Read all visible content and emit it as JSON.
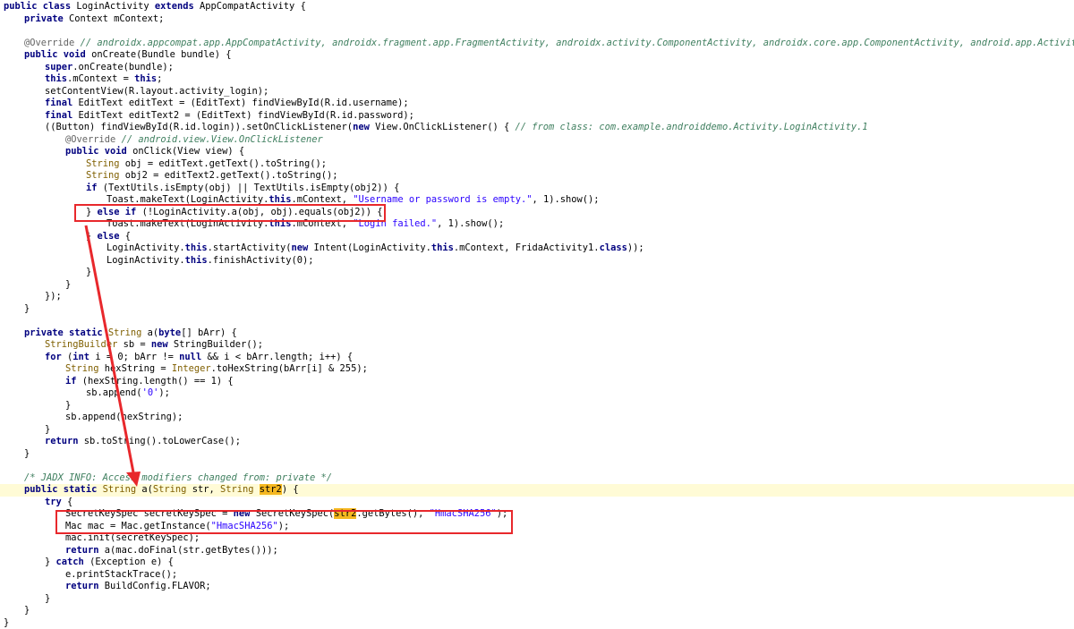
{
  "theme": {
    "annotation_color": "#e8282c",
    "highlight_line_color": "#fffbd6",
    "search_match_color": "#f5b820"
  },
  "lines": [
    {
      "indent": 0,
      "tokens": [
        {
          "t": "public class ",
          "c": "kw"
        },
        {
          "t": "LoginActivity "
        },
        {
          "t": "extends ",
          "c": "kw"
        },
        {
          "t": "AppCompatActivity {"
        }
      ]
    },
    {
      "indent": 1,
      "tokens": [
        {
          "t": "private ",
          "c": "kw"
        },
        {
          "t": "Context mContext;"
        }
      ]
    },
    {
      "indent": 0,
      "tokens": []
    },
    {
      "indent": 1,
      "tokens": [
        {
          "t": "@Override ",
          "c": "ann"
        },
        {
          "t": "// androidx.appcompat.app.AppCompatActivity, androidx.fragment.app.FragmentActivity, androidx.activity.ComponentActivity, androidx.core.app.ComponentActivity, android.app.Activity",
          "c": "comment"
        }
      ]
    },
    {
      "indent": 1,
      "tokens": [
        {
          "t": "public void ",
          "c": "kw"
        },
        {
          "t": "onCreate(Bundle bundle) {"
        }
      ]
    },
    {
      "indent": 2,
      "tokens": [
        {
          "t": "super",
          "c": "kw"
        },
        {
          "t": ".onCreate(bundle);"
        }
      ]
    },
    {
      "indent": 2,
      "tokens": [
        {
          "t": "this",
          "c": "kw"
        },
        {
          "t": ".mContext = "
        },
        {
          "t": "this",
          "c": "kw"
        },
        {
          "t": ";"
        }
      ]
    },
    {
      "indent": 2,
      "tokens": [
        {
          "t": "setContentView(R.layout.activity_login);"
        }
      ]
    },
    {
      "indent": 2,
      "tokens": [
        {
          "t": "final ",
          "c": "kw"
        },
        {
          "t": "EditText editText = (EditText) findViewById(R.id.username);"
        }
      ]
    },
    {
      "indent": 2,
      "tokens": [
        {
          "t": "final ",
          "c": "kw"
        },
        {
          "t": "EditText editText2 = (EditText) findViewById(R.id.password);"
        }
      ]
    },
    {
      "indent": 2,
      "tokens": [
        {
          "t": "((Button) findViewById(R.id.login)).setOnClickListener("
        },
        {
          "t": "new ",
          "c": "kw"
        },
        {
          "t": "View.OnClickListener() { "
        },
        {
          "t": "// from class: com.example.androiddemo.Activity.LoginActivity.1",
          "c": "comment"
        }
      ]
    },
    {
      "indent": 3,
      "tokens": [
        {
          "t": "@Override ",
          "c": "ann"
        },
        {
          "t": "// android.view.View.OnClickListener",
          "c": "comment"
        }
      ]
    },
    {
      "indent": 3,
      "tokens": [
        {
          "t": "public void ",
          "c": "kw"
        },
        {
          "t": "onClick(View view) {"
        }
      ]
    },
    {
      "indent": 4,
      "tokens": [
        {
          "t": "String ",
          "c": "type"
        },
        {
          "t": "obj = editText.getText().toString();"
        }
      ]
    },
    {
      "indent": 4,
      "tokens": [
        {
          "t": "String ",
          "c": "type"
        },
        {
          "t": "obj2 = editText2.getText().toString();"
        }
      ]
    },
    {
      "indent": 4,
      "tokens": [
        {
          "t": "if ",
          "c": "kw"
        },
        {
          "t": "(TextUtils.isEmpty(obj) || TextUtils.isEmpty(obj2)) {"
        }
      ]
    },
    {
      "indent": 5,
      "tokens": [
        {
          "t": "Toast.makeText(LoginActivity."
        },
        {
          "t": "this",
          "c": "kw"
        },
        {
          "t": ".mContext, "
        },
        {
          "t": "\"Username or password is empty.\"",
          "c": "string"
        },
        {
          "t": ", 1).show();"
        }
      ]
    },
    {
      "indent": 4,
      "tokens": [
        {
          "t": "} "
        },
        {
          "t": "else if ",
          "c": "kw"
        },
        {
          "t": "(!LoginActivity.a(obj, obj).equals(obj2)) {"
        }
      ]
    },
    {
      "indent": 5,
      "tokens": [
        {
          "t": "Toast.makeText(LoginActivity."
        },
        {
          "t": "this",
          "c": "kw"
        },
        {
          "t": ".mContext, "
        },
        {
          "t": "\"Login failed.\"",
          "c": "string"
        },
        {
          "t": ", 1).show();"
        }
      ]
    },
    {
      "indent": 4,
      "tokens": [
        {
          "t": "} "
        },
        {
          "t": "else ",
          "c": "kw"
        },
        {
          "t": "{"
        }
      ]
    },
    {
      "indent": 5,
      "tokens": [
        {
          "t": "LoginActivity."
        },
        {
          "t": "this",
          "c": "kw"
        },
        {
          "t": ".startActivity("
        },
        {
          "t": "new ",
          "c": "kw"
        },
        {
          "t": "Intent(LoginActivity."
        },
        {
          "t": "this",
          "c": "kw"
        },
        {
          "t": ".mContext, FridaActivity1."
        },
        {
          "t": "class",
          "c": "kw"
        },
        {
          "t": "));"
        }
      ]
    },
    {
      "indent": 5,
      "tokens": [
        {
          "t": "LoginActivity."
        },
        {
          "t": "this",
          "c": "kw"
        },
        {
          "t": ".finishActivity(0);"
        }
      ]
    },
    {
      "indent": 4,
      "tokens": [
        {
          "t": "}"
        }
      ]
    },
    {
      "indent": 3,
      "tokens": [
        {
          "t": "}"
        }
      ]
    },
    {
      "indent": 2,
      "tokens": [
        {
          "t": "});"
        }
      ]
    },
    {
      "indent": 1,
      "tokens": [
        {
          "t": "}"
        }
      ]
    },
    {
      "indent": 0,
      "tokens": []
    },
    {
      "indent": 1,
      "tokens": [
        {
          "t": "private static ",
          "c": "kw"
        },
        {
          "t": "String ",
          "c": "type"
        },
        {
          "t": "a("
        },
        {
          "t": "byte",
          "c": "kw"
        },
        {
          "t": "[] bArr) {"
        }
      ]
    },
    {
      "indent": 2,
      "tokens": [
        {
          "t": "StringBuilder ",
          "c": "type"
        },
        {
          "t": "sb = "
        },
        {
          "t": "new ",
          "c": "kw"
        },
        {
          "t": "StringBuilder();"
        }
      ]
    },
    {
      "indent": 2,
      "tokens": [
        {
          "t": "for ",
          "c": "kw"
        },
        {
          "t": "("
        },
        {
          "t": "int ",
          "c": "kw"
        },
        {
          "t": "i = 0; bArr != "
        },
        {
          "t": "null ",
          "c": "kw"
        },
        {
          "t": "&& i < bArr.length; i++) {"
        }
      ]
    },
    {
      "indent": 3,
      "tokens": [
        {
          "t": "String ",
          "c": "type"
        },
        {
          "t": "hexString = "
        },
        {
          "t": "Integer",
          "c": "type"
        },
        {
          "t": ".toHexString(bArr[i] & 255);"
        }
      ]
    },
    {
      "indent": 3,
      "tokens": [
        {
          "t": "if ",
          "c": "kw"
        },
        {
          "t": "(hexString.length() == 1) {"
        }
      ]
    },
    {
      "indent": 4,
      "tokens": [
        {
          "t": "sb.append("
        },
        {
          "t": "'0'",
          "c": "string"
        },
        {
          "t": ");"
        }
      ]
    },
    {
      "indent": 3,
      "tokens": [
        {
          "t": "}"
        }
      ]
    },
    {
      "indent": 3,
      "tokens": [
        {
          "t": "sb.append(hexString);"
        }
      ]
    },
    {
      "indent": 2,
      "tokens": [
        {
          "t": "}"
        }
      ]
    },
    {
      "indent": 2,
      "tokens": [
        {
          "t": "return ",
          "c": "kw"
        },
        {
          "t": "sb.toString().toLowerCase();"
        }
      ]
    },
    {
      "indent": 1,
      "tokens": [
        {
          "t": "}"
        }
      ]
    },
    {
      "indent": 0,
      "tokens": []
    },
    {
      "indent": 1,
      "tokens": [
        {
          "t": "/* JADX INFO: Access modifiers changed from: private */",
          "c": "comment"
        }
      ]
    },
    {
      "indent": 1,
      "hl": true,
      "tokens": [
        {
          "t": "public static ",
          "c": "kw"
        },
        {
          "t": "String ",
          "c": "type"
        },
        {
          "t": "a("
        },
        {
          "t": "String ",
          "c": "type"
        },
        {
          "t": "str, "
        },
        {
          "t": "String ",
          "c": "type"
        },
        {
          "t": "str2",
          "c": "mark"
        },
        {
          "t": ") {"
        }
      ]
    },
    {
      "indent": 2,
      "tokens": [
        {
          "t": "try ",
          "c": "kw"
        },
        {
          "t": "{"
        }
      ]
    },
    {
      "indent": 3,
      "tokens": [
        {
          "t": "SecretKeySpec secretKeySpec = "
        },
        {
          "t": "new ",
          "c": "kw"
        },
        {
          "t": "SecretKeySpec("
        },
        {
          "t": "str2",
          "c": "mark"
        },
        {
          "t": ".getBytes(), "
        },
        {
          "t": "\"HmacSHA256\"",
          "c": "string"
        },
        {
          "t": ");"
        }
      ]
    },
    {
      "indent": 3,
      "tokens": [
        {
          "t": "Mac mac = Mac.getInstance("
        },
        {
          "t": "\"HmacSHA256\"",
          "c": "string"
        },
        {
          "t": ");"
        }
      ]
    },
    {
      "indent": 3,
      "tokens": [
        {
          "t": "mac.init(secretKeySpec);"
        }
      ]
    },
    {
      "indent": 3,
      "tokens": [
        {
          "t": "return ",
          "c": "kw"
        },
        {
          "t": "a(mac.doFinal(str.getBytes()));"
        }
      ]
    },
    {
      "indent": 2,
      "tokens": [
        {
          "t": "} "
        },
        {
          "t": "catch ",
          "c": "kw"
        },
        {
          "t": "(Exception e) {"
        }
      ]
    },
    {
      "indent": 3,
      "tokens": [
        {
          "t": "e.printStackTrace();"
        }
      ]
    },
    {
      "indent": 3,
      "tokens": [
        {
          "t": "return ",
          "c": "kw"
        },
        {
          "t": "BuildConfig.FLAVOR;"
        }
      ]
    },
    {
      "indent": 2,
      "tokens": [
        {
          "t": "}"
        }
      ]
    },
    {
      "indent": 1,
      "tokens": [
        {
          "t": "}"
        }
      ]
    },
    {
      "indent": 0,
      "tokens": [
        {
          "t": "}"
        }
      ]
    }
  ]
}
